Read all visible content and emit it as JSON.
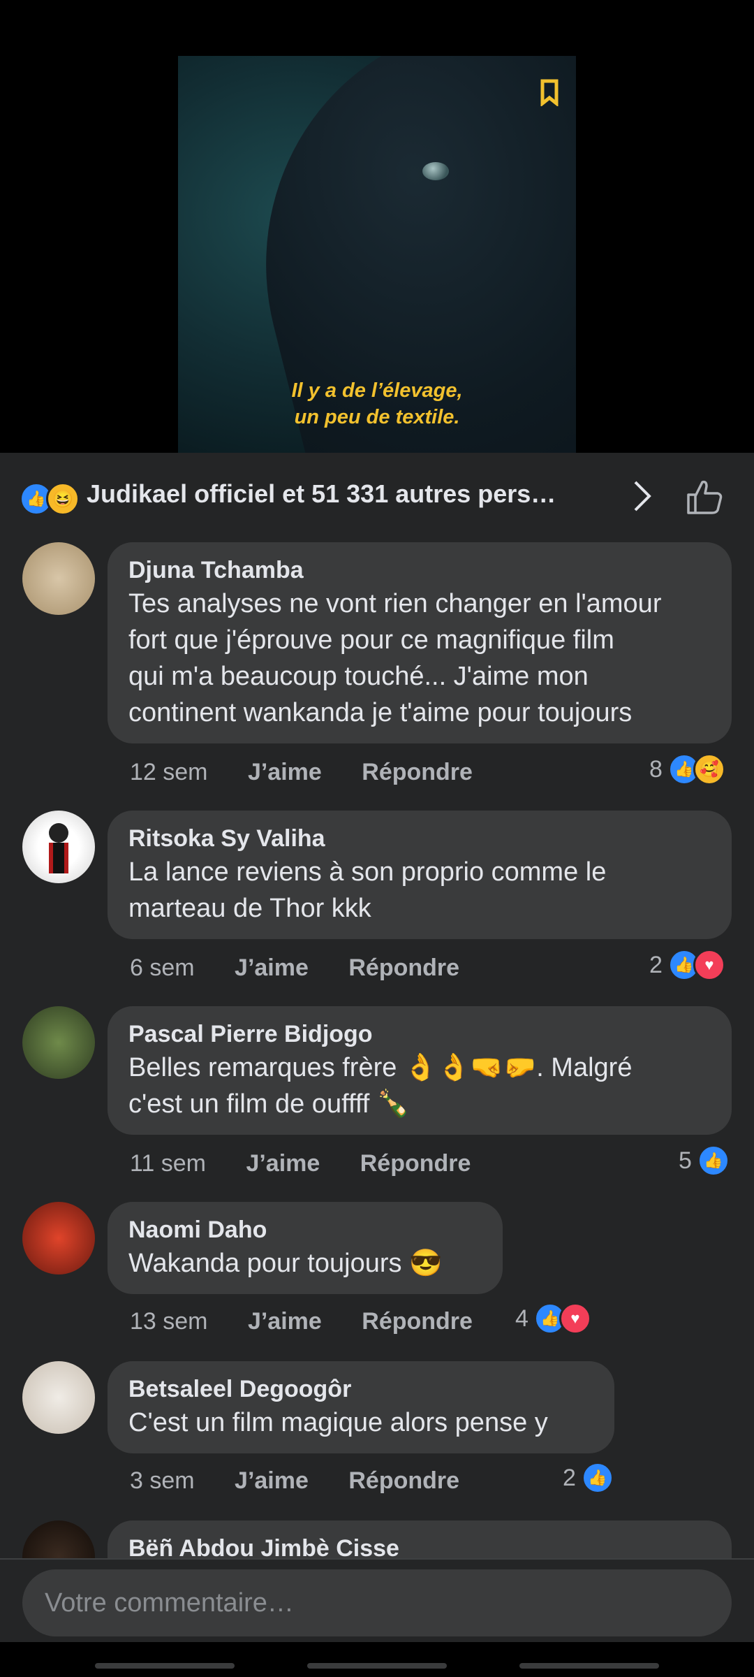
{
  "video": {
    "subtitle_line1": "Il y a de l’élevage,",
    "subtitle_line2": "un peu de textile.",
    "badge_icon": "bookmark-icon",
    "subtitle_color": "#f2c12e"
  },
  "reactions": {
    "icons": [
      "like-icon",
      "haha-icon"
    ],
    "text": "Judikael officiel et 51 331 autres pers…"
  },
  "comments": [
    {
      "name": "Djuna Tchamba",
      "lines": [
        "Tes analyses ne vont rien changer en l'amour",
        "fort que j'éprouve pour ce magnifique film",
        "qui m'a beaucoup touché... J'aime mon",
        "continent wankanda je t'aime pour toujours"
      ],
      "time": "12 sem",
      "like_label": "J’aime",
      "reply_label": "Répondre",
      "reaction_count": "8",
      "reaction_icons": [
        "like",
        "care"
      ]
    },
    {
      "name": "Ritsoka Sy Valiha",
      "lines": [
        "La lance reviens à son proprio comme le",
        "marteau de Thor kkk"
      ],
      "time": "6 sem",
      "like_label": "J’aime",
      "reply_label": "Répondre",
      "reaction_count": "2",
      "reaction_icons": [
        "like",
        "love"
      ]
    },
    {
      "name": "Pascal Pierre Bidjogo",
      "lines": [
        "Belles remarques frère 👌👌🤜🤛. Malgré",
        "c'est un film de ouffff 🍾"
      ],
      "time": "11 sem",
      "like_label": "J’aime",
      "reply_label": "Répondre",
      "reaction_count": "5",
      "reaction_icons": [
        "like"
      ]
    },
    {
      "name": "Naomi Daho",
      "lines": [
        "Wakanda pour toujours 😎"
      ],
      "time": "13 sem",
      "like_label": "J’aime",
      "reply_label": "Répondre",
      "reaction_count": "4",
      "reaction_icons": [
        "like",
        "love"
      ]
    },
    {
      "name": "Betsaleel Degoogôr",
      "lines": [
        "C'est un film magique alors pense y"
      ],
      "time": "3 sem",
      "like_label": "J’aime",
      "reply_label": "Répondre",
      "reaction_count": "2",
      "reaction_icons": [
        "like"
      ]
    },
    {
      "name": "Bëñ Abdou Jimbè Cisse",
      "lines": []
    }
  ],
  "composer": {
    "placeholder": "Votre commentaire…"
  }
}
